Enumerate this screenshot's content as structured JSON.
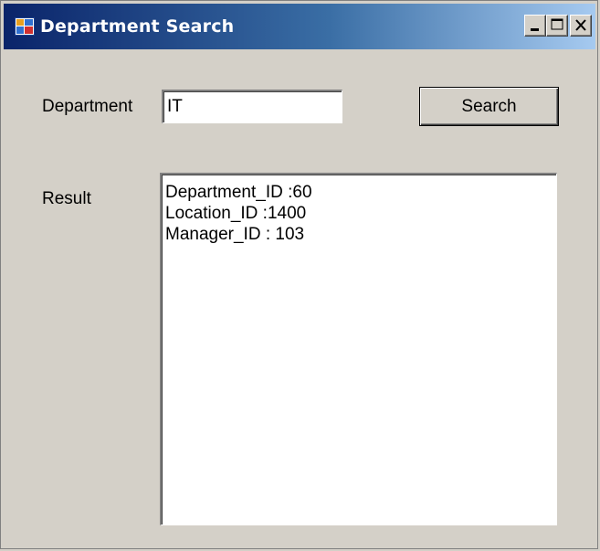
{
  "window": {
    "title": "Department Search",
    "controls": {
      "minimize": "_",
      "maximize": "□",
      "close": "✕"
    }
  },
  "form": {
    "department_label": "Department",
    "department_value": "IT",
    "search_button": "Search",
    "result_label": "Result",
    "result_lines": [
      "Department_ID :60",
      "Location_ID :1400",
      "Manager_ID : 103"
    ]
  }
}
